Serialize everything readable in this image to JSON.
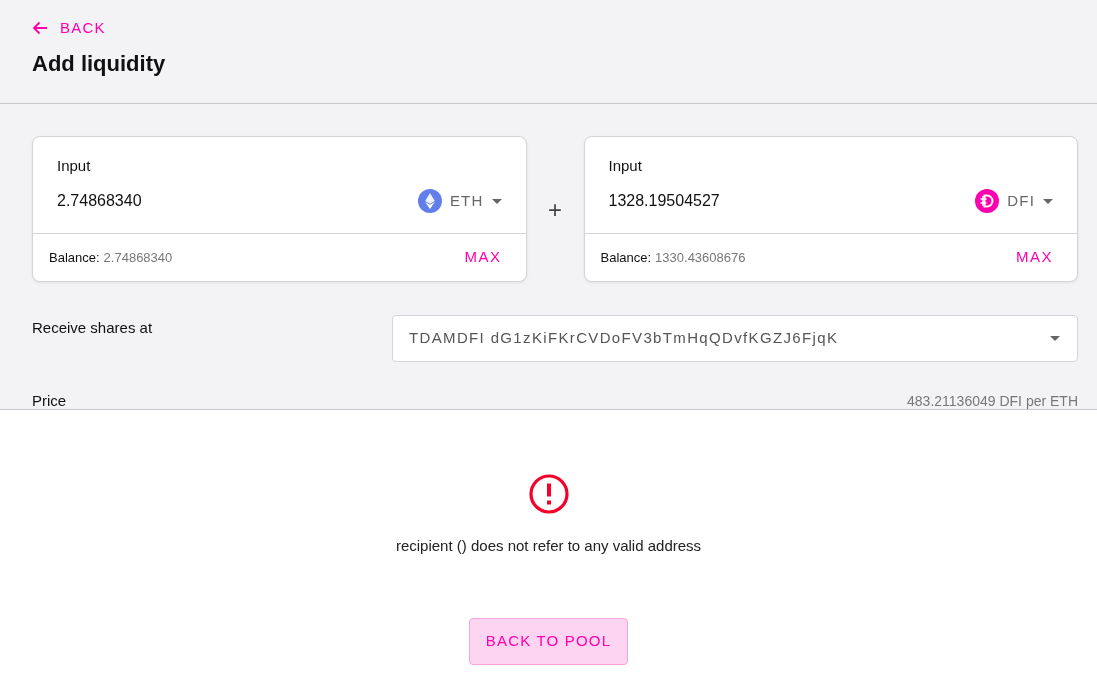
{
  "header": {
    "back_link": "BACK",
    "title": "Add liquidity"
  },
  "inputs": [
    {
      "label": "Input",
      "value": "2.74868340",
      "token": "ETH",
      "kind": "eth",
      "balance_label": "Balance:",
      "balance": "2.74868340",
      "max_button": "MAX"
    },
    {
      "label": "Input",
      "value": "1328.19504527",
      "token": "DFI",
      "kind": "dfi",
      "balance_label": "Balance:",
      "balance": "1330.43608676",
      "max_button": "MAX"
    }
  ],
  "plus_sign": "+",
  "receive_shares": {
    "label": "Receive shares at",
    "address": "TDAMDFI dG1zKiFKrCVDoFV3bTmHqQDvfKGZJ6FjqK"
  },
  "price": {
    "label": "Price",
    "value": "483.21136049 DFI per ETH"
  },
  "error_overlay": {
    "message": "recipient () does not refer to any valid address",
    "button": "BACK TO POOL"
  }
}
